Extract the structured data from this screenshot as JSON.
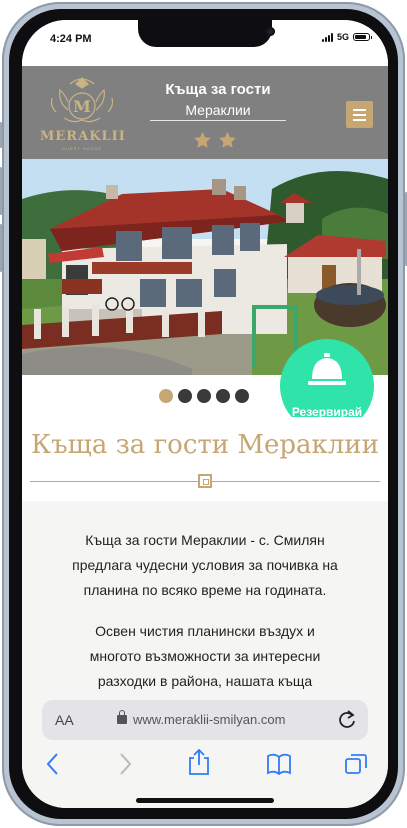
{
  "status_bar": {
    "time": "4:24 PM",
    "network": "5G",
    "battery_icon": "battery-icon",
    "signal_icon": "signal-icon"
  },
  "header": {
    "logo_text": "MERAKLII",
    "logo_subtext": "GUEST HOUSE",
    "logo_letter": "M",
    "title": "Къща за гости",
    "subtitle": "Мераклии",
    "star_rating": 2,
    "menu_icon": "hamburger-icon"
  },
  "hero": {
    "image_description_icon": "house-photo",
    "slides_count": 5,
    "active_slide": 1
  },
  "reserve_button": {
    "label": "Резервирай",
    "icon": "bell-icon"
  },
  "main": {
    "page_title": "Къща за гости Мераклии",
    "paragraphs": [
      [
        "Къща за гости Мераклии - с. Смилян",
        "предлага чудесни условия за почивка на",
        "планина по всяко време на годината."
      ],
      [
        "Освен чистия планински въздух и",
        "многото възможности за интересни",
        "разходки в района, нашата къща"
      ]
    ]
  },
  "browser": {
    "aa_label": "AA",
    "url": "www.meraklii-smilyan.com",
    "toolbar": [
      "back-icon",
      "forward-icon",
      "share-icon",
      "bookmarks-icon",
      "tabs-icon"
    ]
  },
  "colors": {
    "accent_gold": "#c6a673",
    "header_gray": "#808080",
    "reserve_green": "#2fe3a9",
    "dot_dark": "#3a3a3a"
  }
}
